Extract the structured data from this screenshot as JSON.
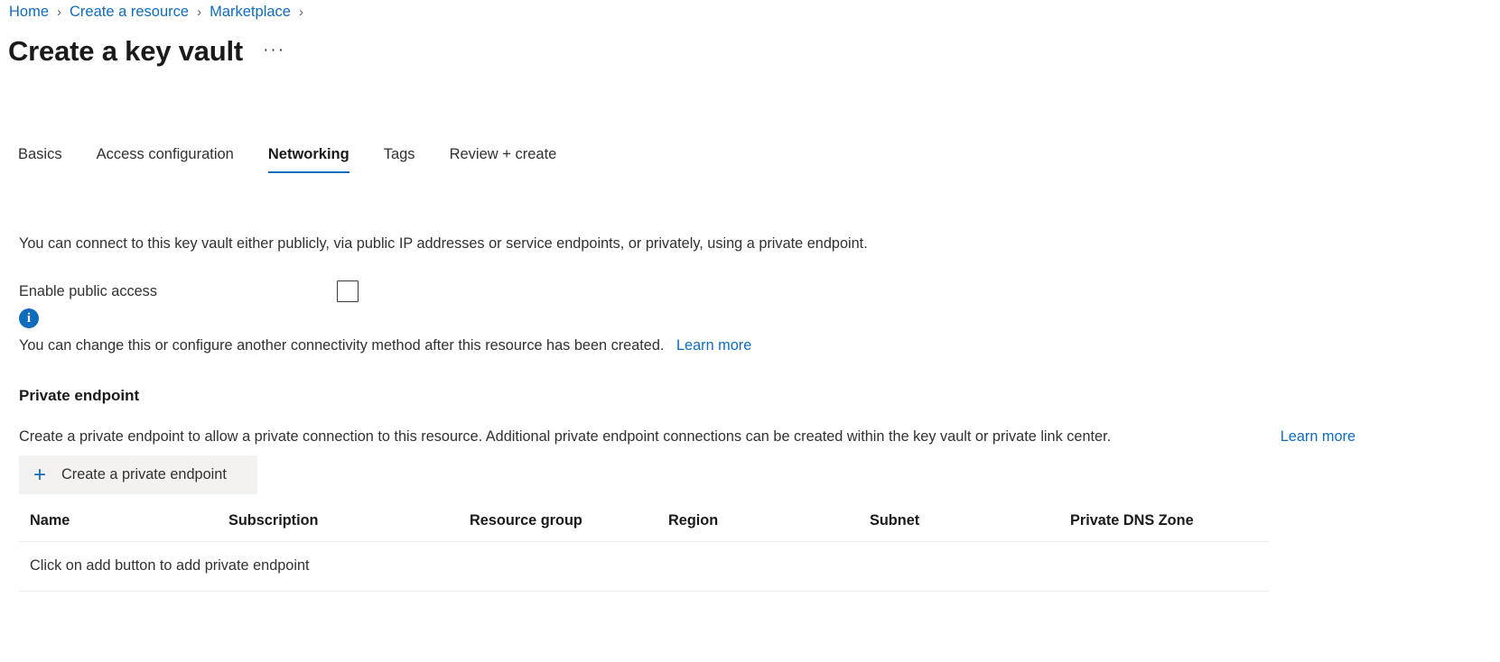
{
  "breadcrumb": {
    "items": [
      {
        "label": "Home"
      },
      {
        "label": "Create a resource"
      },
      {
        "label": "Marketplace"
      }
    ],
    "separator": "›"
  },
  "header": {
    "title": "Create a key vault",
    "more_actions": "···"
  },
  "tabs": [
    {
      "label": "Basics",
      "active": false
    },
    {
      "label": "Access configuration",
      "active": false
    },
    {
      "label": "Networking",
      "active": true
    },
    {
      "label": "Tags",
      "active": false
    },
    {
      "label": "Review + create",
      "active": false
    }
  ],
  "networking": {
    "intro": "You can connect to this key vault either publicly, via public IP addresses or service endpoints, or privately, using a private endpoint.",
    "enable_public_access": {
      "label": "Enable public access",
      "checked": false
    },
    "info": {
      "icon": "info-icon",
      "text": "You can change this or configure another connectivity method after this resource has been created.",
      "link_label": "Learn more"
    }
  },
  "private_endpoint": {
    "heading": "Private endpoint",
    "description": "Create a private endpoint to allow a private connection to this resource. Additional private endpoint connections can be created within the key vault or private link center.",
    "link_label": "Learn more",
    "add_button": {
      "label": "Create a private endpoint",
      "icon": "plus-icon"
    },
    "table": {
      "columns": [
        "Name",
        "Subscription",
        "Resource group",
        "Region",
        "Subnet",
        "Private DNS Zone"
      ],
      "rows": [],
      "empty_message": "Click on add button to add private endpoint"
    }
  },
  "colors": {
    "link": "#0f6cbd",
    "accent": "#0f6cbd",
    "text": "#323130",
    "button_bg": "#f3f2f1",
    "divider": "#edebe9"
  }
}
